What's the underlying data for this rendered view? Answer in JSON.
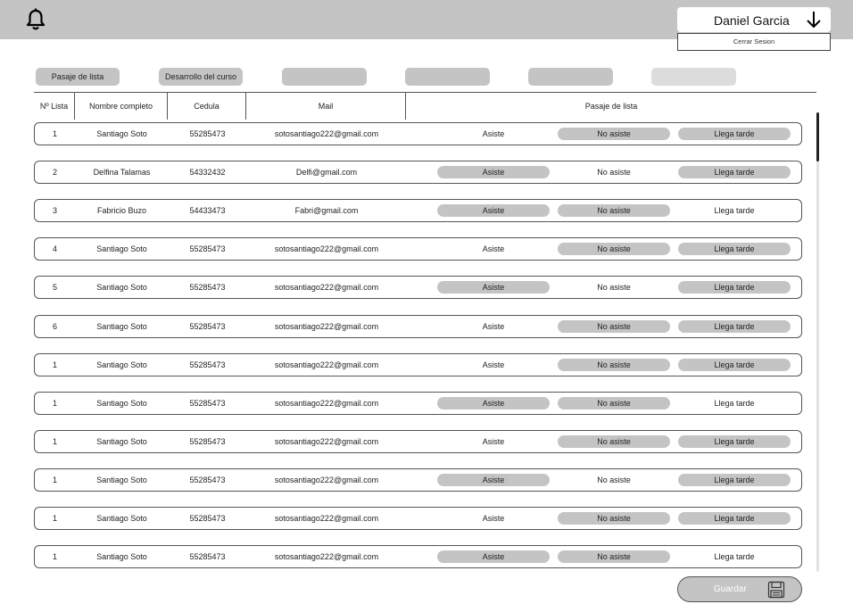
{
  "header": {
    "user_name": "Daniel Garcia",
    "logout_label": "Cerrar Sesion",
    "bell_icon": "bell-icon",
    "dropdown_icon": "arrow-down-icon"
  },
  "tabs": [
    {
      "label": "Pasaje de lista"
    },
    {
      "label": "Desarrollo del curso"
    },
    {
      "label": ""
    },
    {
      "label": ""
    },
    {
      "label": ""
    },
    {
      "label": ""
    }
  ],
  "table": {
    "headers": {
      "num": "Nº Lista",
      "name": "Nombre completo",
      "cedula": "Cedula",
      "mail": "Mail",
      "attendance": "Pasaje de lista"
    },
    "option_labels": {
      "asiste": "Asiste",
      "no_asiste": "No asiste",
      "tarde": "Llega tarde"
    },
    "rows": [
      {
        "num": "1",
        "name": "Santiago Soto",
        "cedula": "55285473",
        "mail": "sotosantiago222@gmail.com",
        "status": "asiste"
      },
      {
        "num": "2",
        "name": "Delfina Talamas",
        "cedula": "54332432",
        "mail": "Delfi@gmail.com",
        "status": "no_asiste"
      },
      {
        "num": "3",
        "name": "Fabricio Buzo",
        "cedula": "54433473",
        "mail": "Fabri@gmail.com",
        "status": "tarde"
      },
      {
        "num": "4",
        "name": "Santiago Soto",
        "cedula": "55285473",
        "mail": "sotosantiago222@gmail.com",
        "status": "asiste"
      },
      {
        "num": "5",
        "name": "Santiago Soto",
        "cedula": "55285473",
        "mail": "sotosantiago222@gmail.com",
        "status": "no_asiste"
      },
      {
        "num": "6",
        "name": "Santiago Soto",
        "cedula": "55285473",
        "mail": "sotosantiago222@gmail.com",
        "status": "asiste"
      },
      {
        "num": "1",
        "name": "Santiago Soto",
        "cedula": "55285473",
        "mail": "sotosantiago222@gmail.com",
        "status": "asiste"
      },
      {
        "num": "1",
        "name": "Santiago Soto",
        "cedula": "55285473",
        "mail": "sotosantiago222@gmail.com",
        "status": "tarde"
      },
      {
        "num": "1",
        "name": "Santiago Soto",
        "cedula": "55285473",
        "mail": "sotosantiago222@gmail.com",
        "status": "asiste"
      },
      {
        "num": "1",
        "name": "Santiago Soto",
        "cedula": "55285473",
        "mail": "sotosantiago222@gmail.com",
        "status": "no_asiste"
      },
      {
        "num": "1",
        "name": "Santiago Soto",
        "cedula": "55285473",
        "mail": "sotosantiago222@gmail.com",
        "status": "asiste"
      },
      {
        "num": "1",
        "name": "Santiago Soto",
        "cedula": "55285473",
        "mail": "sotosantiago222@gmail.com",
        "status": "tarde"
      }
    ]
  },
  "footer": {
    "save_label": "Guardar",
    "save_icon": "floppy-disk-icon"
  },
  "colors": {
    "topbar": "#c4c4c4",
    "pill_active": "#c4c4c4",
    "border": "#555555"
  }
}
